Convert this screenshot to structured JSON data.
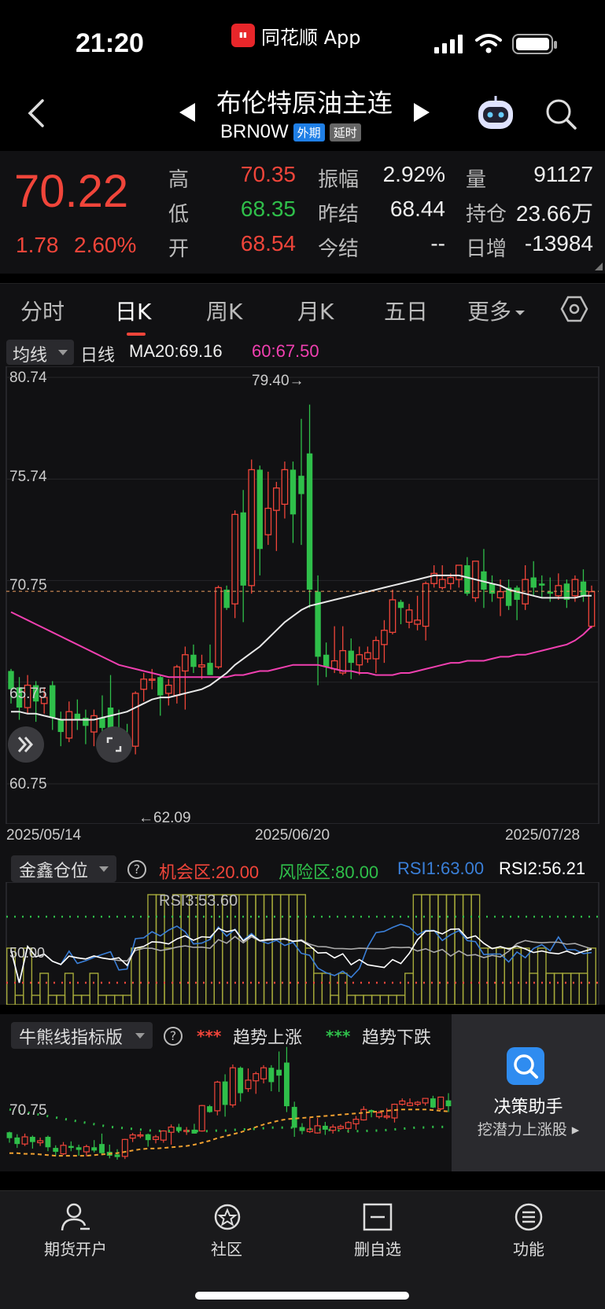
{
  "status_bar": {
    "time": "21:20",
    "app_name": "同花顺 App"
  },
  "header": {
    "title": "布伦特原油主连",
    "code": "BRN0W",
    "tag_market": "外期",
    "tag_delay": "延时"
  },
  "quote": {
    "last": "70.22",
    "change": "1.78",
    "change_pct": "2.60%",
    "high_label": "高",
    "high": "70.35",
    "low_label": "低",
    "low": "68.35",
    "open_label": "开",
    "open": "68.54",
    "amp_label": "振幅",
    "amp": "2.92%",
    "prev_label": "昨结",
    "prev": "68.44",
    "today_label": "今结",
    "today": "--",
    "vol_label": "量",
    "vol": "91127",
    "oi_label": "持仓",
    "oi": "23.66万",
    "daily_inc_label": "日增",
    "daily_inc": "-13984"
  },
  "tabs": [
    {
      "label": "分时"
    },
    {
      "label": "日K"
    },
    {
      "label": "周K"
    },
    {
      "label": "月K"
    },
    {
      "label": "五日"
    },
    {
      "label": "更多"
    }
  ],
  "ma_legend": {
    "select": "均线",
    "period": "日线",
    "ma20": "MA20:69.16",
    "ma60": "60:67.50"
  },
  "chart_data": {
    "type": "candlestick",
    "y_axis_labels": [
      "80.74",
      "75.74",
      "70.75",
      "65.75",
      "60.75"
    ],
    "ylim": [
      60.75,
      80.74
    ],
    "x_axis_labels": [
      "2025/05/14",
      "2025/06/20",
      "2025/07/28"
    ],
    "max_annotation": "79.40→",
    "min_annotation": "←62.09",
    "last_price_line": 70.22,
    "colors": {
      "up": "#f0453a",
      "down": "#2fbf4a",
      "ma20": "#e8e8e8",
      "ma60": "#f040b0"
    },
    "candles": [
      [
        66.3,
        66.4,
        64.7,
        65.4
      ],
      [
        65.5,
        66.0,
        63.9,
        64.5
      ],
      [
        64.5,
        66.1,
        64.2,
        65.6
      ],
      [
        65.6,
        65.8,
        63.8,
        64.8
      ],
      [
        64.7,
        65.5,
        64.2,
        65.0
      ],
      [
        65.6,
        65.8,
        63.4,
        64.0
      ],
      [
        63.9,
        64.3,
        62.6,
        63.3
      ],
      [
        63.0,
        64.8,
        62.8,
        64.3
      ],
      [
        64.2,
        64.9,
        63.4,
        63.9
      ],
      [
        64.0,
        64.4,
        62.7,
        63.6
      ],
      [
        63.3,
        64.4,
        62.6,
        64.1
      ],
      [
        64.0,
        65.1,
        63.2,
        63.5
      ],
      [
        64.5,
        66.1,
        62.8,
        63.1
      ],
      [
        63.3,
        64.4,
        62.3,
        62.7
      ],
      [
        62.9,
        63.7,
        62.1,
        62.5
      ],
      [
        62.6,
        65.3,
        62.2,
        65.2
      ],
      [
        65.4,
        66.2,
        64.8,
        65.9
      ],
      [
        65.9,
        66.4,
        65.4,
        65.9
      ],
      [
        66.0,
        66.1,
        64.1,
        65.1
      ],
      [
        65.2,
        65.9,
        64.6,
        65.6
      ],
      [
        65.1,
        66.6,
        64.7,
        66.5
      ],
      [
        66.3,
        67.5,
        64.4,
        67.1
      ],
      [
        67.1,
        67.6,
        66.2,
        66.5
      ],
      [
        66.5,
        67.1,
        65.9,
        66.6
      ],
      [
        66.7,
        67.6,
        66.1,
        66.1
      ],
      [
        66.5,
        70.5,
        66.4,
        70.4
      ],
      [
        70.3,
        70.5,
        69.3,
        69.4
      ],
      [
        69.6,
        74.2,
        68.9,
        74.0
      ],
      [
        74.1,
        75.2,
        68.7,
        70.5
      ],
      [
        70.5,
        76.7,
        70.1,
        76.2
      ],
      [
        76.2,
        76.4,
        71.0,
        72.3
      ],
      [
        73.0,
        76.1,
        72.5,
        74.3
      ],
      [
        74.2,
        75.6,
        72.2,
        75.3
      ],
      [
        74.5,
        76.6,
        73.8,
        76.2
      ],
      [
        76.2,
        76.6,
        72.6,
        74.0
      ],
      [
        75.9,
        78.7,
        72.5,
        75.0
      ],
      [
        77.0,
        79.4,
        69.4,
        70.3
      ],
      [
        70.2,
        71.0,
        65.6,
        67.0
      ],
      [
        67.1,
        67.7,
        66.0,
        66.5
      ],
      [
        66.4,
        68.5,
        66.2,
        66.8
      ],
      [
        66.2,
        68.5,
        66.1,
        67.3
      ],
      [
        67.3,
        67.9,
        65.9,
        66.7
      ],
      [
        66.6,
        67.5,
        66.1,
        67.1
      ],
      [
        66.9,
        67.5,
        66.7,
        67.2
      ],
      [
        66.9,
        68.0,
        66.2,
        67.8
      ],
      [
        67.6,
        68.8,
        66.7,
        68.3
      ],
      [
        68.2,
        70.3,
        68.1,
        69.8
      ],
      [
        69.7,
        69.8,
        68.6,
        69.4
      ],
      [
        68.7,
        69.6,
        68.4,
        69.3
      ],
      [
        68.6,
        70.0,
        68.3,
        68.8
      ],
      [
        68.5,
        70.7,
        67.8,
        70.6
      ],
      [
        70.6,
        71.5,
        70.4,
        71.1
      ],
      [
        70.4,
        71.5,
        70.3,
        70.8
      ],
      [
        70.6,
        71.1,
        70.3,
        70.9
      ],
      [
        70.8,
        71.3,
        70.4,
        71.5
      ],
      [
        71.5,
        71.9,
        70.0,
        70.1
      ],
      [
        69.9,
        71.5,
        69.7,
        71.7
      ],
      [
        71.2,
        72.3,
        69.4,
        70.3
      ],
      [
        70.6,
        71.0,
        69.7,
        70.1
      ],
      [
        69.9,
        70.8,
        69.0,
        70.2
      ],
      [
        70.4,
        70.8,
        69.3,
        69.5
      ],
      [
        70.4,
        70.5,
        68.8,
        69.8
      ],
      [
        69.6,
        71.5,
        69.3,
        70.8
      ],
      [
        70.9,
        71.7,
        70.0,
        70.4
      ],
      [
        70.6,
        71.0,
        69.9,
        70.5
      ],
      [
        70.2,
        70.9,
        69.7,
        70.1
      ],
      [
        70.0,
        71.1,
        69.8,
        70.5
      ],
      [
        70.6,
        70.8,
        69.4,
        69.8
      ],
      [
        70.0,
        71.0,
        69.7,
        70.8
      ],
      [
        70.7,
        71.3,
        69.7,
        70.0
      ],
      [
        68.5,
        70.5,
        68.4,
        70.2
      ]
    ],
    "ma20": [
      64.3,
      64.3,
      64.2,
      64.2,
      64.1,
      64.0,
      63.9,
      63.9,
      63.9,
      63.9,
      63.9,
      64.0,
      64.1,
      64.2,
      64.3,
      64.5,
      64.7,
      64.9,
      65.0,
      65.0,
      65.1,
      65.2,
      65.3,
      65.4,
      65.6,
      65.9,
      66.2,
      66.6,
      66.9,
      67.2,
      67.5,
      67.9,
      68.3,
      68.7,
      69.0,
      69.3,
      69.5,
      69.6,
      69.7,
      69.8,
      69.9,
      70.0,
      70.1,
      70.2,
      70.3,
      70.4,
      70.5,
      70.6,
      70.7,
      70.8,
      70.9,
      71.0,
      71.0,
      71.0,
      71.0,
      70.9,
      70.8,
      70.7,
      70.6,
      70.5,
      70.3,
      70.2,
      70.1,
      70.0,
      69.9,
      69.9,
      69.9,
      69.9,
      69.9,
      70.0,
      70.0
    ],
    "ma60": [
      69.2,
      69.0,
      68.8,
      68.6,
      68.4,
      68.2,
      68.0,
      67.8,
      67.6,
      67.4,
      67.2,
      67.0,
      66.8,
      66.6,
      66.5,
      66.4,
      66.3,
      66.2,
      66.1,
      66.0,
      66.0,
      66.0,
      66.0,
      66.0,
      66.0,
      66.0,
      66.0,
      66.1,
      66.1,
      66.2,
      66.3,
      66.3,
      66.4,
      66.5,
      66.6,
      66.6,
      66.6,
      66.6,
      66.5,
      66.4,
      66.3,
      66.3,
      66.2,
      66.2,
      66.1,
      66.1,
      66.1,
      66.2,
      66.2,
      66.3,
      66.4,
      66.5,
      66.6,
      66.7,
      66.7,
      66.8,
      66.8,
      66.8,
      66.9,
      67.0,
      67.0,
      67.1,
      67.1,
      67.2,
      67.3,
      67.4,
      67.5,
      67.6,
      67.8,
      68.1,
      68.5
    ]
  },
  "rsi": {
    "select": "金鑫仓位",
    "opportunity": "机会区:20.00",
    "risk": "风险区:80.00",
    "rsi1": "RSI1:63.00",
    "rsi2": "RSI2:56.21",
    "rsi3": "RSI3:53.60",
    "axis_50": "50.00",
    "colors": {
      "rsi1": "#3a7fd8",
      "rsi2": "#ffffff",
      "rsi3": "#aaaaaa",
      "bars": "#a5a93a",
      "risk": "#2fbf4a",
      "chance": "#f0453a"
    }
  },
  "bull_bear": {
    "select": "牛熊线指标版",
    "up_marker": "***",
    "up_label": "趋势上涨",
    "down_marker": "***",
    "down_label": "趋势下跌",
    "axis_label": "70.75"
  },
  "assistant": {
    "title": "决策助手",
    "subtitle": "挖潜力上涨股 ▸"
  },
  "bottom_nav": [
    {
      "label": "期货开户"
    },
    {
      "label": "社区"
    },
    {
      "label": "删自选"
    },
    {
      "label": "功能"
    }
  ]
}
